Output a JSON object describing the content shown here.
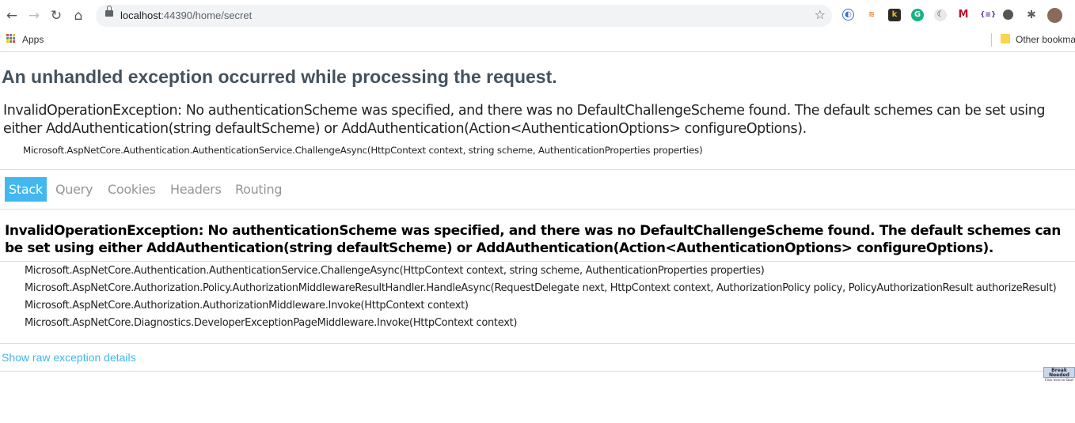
{
  "browser": {
    "url_host": "localhost",
    "url_rest": ":44390/home/secret",
    "bookmarks": {
      "apps": "Apps",
      "other": "Other bookmarks"
    },
    "extensions": [
      "ext-blue-icon",
      "ext-orange-icon",
      "k-icon",
      "grammarly-icon",
      "dark-reader-icon",
      "mcafee-icon",
      "json-icon",
      "circle-icon",
      "puzzle-icon"
    ]
  },
  "page": {
    "title": "An unhandled exception occurred while processing the request.",
    "error_message": "InvalidOperationException: No authenticationScheme was specified, and there was no DefaultChallengeScheme found. The default schemes can be set using either AddAuthentication(string defaultScheme) or AddAuthentication(Action<AuthenticationOptions> configureOptions).",
    "location": "Microsoft.AspNetCore.Authentication.AuthenticationService.ChallengeAsync(HttpContext context, string scheme, AuthenticationProperties properties)",
    "tabs": [
      "Stack",
      "Query",
      "Cookies",
      "Headers",
      "Routing"
    ],
    "active_tab": "Stack",
    "stack_error": "InvalidOperationException: No authenticationScheme was specified, and there was no DefaultChallengeScheme found. The default schemes can be set using either AddAuthentication(string defaultScheme) or AddAuthentication(Action<AuthenticationOptions> configureOptions).",
    "frames": [
      "Microsoft.AspNetCore.Authentication.AuthenticationService.ChallengeAsync(HttpContext context, string scheme, AuthenticationProperties properties)",
      "Microsoft.AspNetCore.Authorization.Policy.AuthorizationMiddlewareResultHandler.HandleAsync(RequestDelegate next, HttpContext context, AuthorizationPolicy policy, PolicyAuthorizationResult authorizeResult)",
      "Microsoft.AspNetCore.Authorization.AuthorizationMiddleware.Invoke(HttpContext context)",
      "Microsoft.AspNetCore.Diagnostics.DeveloperExceptionPageMiddleware.Invoke(HttpContext context)"
    ],
    "raw_link": "Show raw exception details",
    "badge": {
      "line1": "Break Needed",
      "line2": "Click here to Start"
    }
  },
  "colors": {
    "accent": "#42b7f0",
    "heading": "#44525e"
  }
}
